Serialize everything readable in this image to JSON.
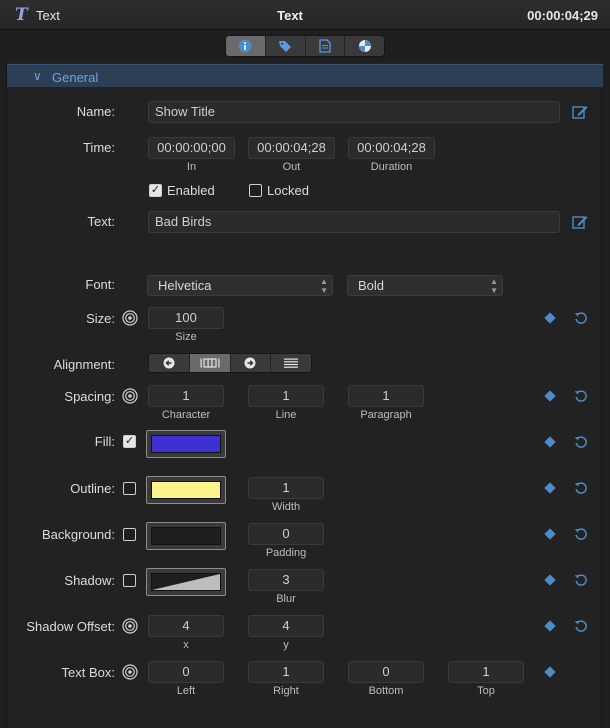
{
  "titlebar": {
    "icon": "T",
    "name": "Text",
    "title": "Text",
    "timecode": "00:00:04;29"
  },
  "tabs": [
    {
      "name": "info-icon",
      "active": true
    },
    {
      "name": "tag-icon",
      "active": false
    },
    {
      "name": "document-icon",
      "active": false
    },
    {
      "name": "color-wheel-icon",
      "active": false
    }
  ],
  "section": {
    "label": "General",
    "chevron": "∨"
  },
  "name": {
    "label": "Name:",
    "value": "Show Title"
  },
  "time": {
    "label": "Time:",
    "in": {
      "value": "00:00:00;00",
      "caption": "In"
    },
    "out": {
      "value": "00:00:04;28",
      "caption": "Out"
    },
    "duration": {
      "value": "00:00:04;28",
      "caption": "Duration"
    },
    "enabled": {
      "label": "Enabled",
      "checked": true
    },
    "locked": {
      "label": "Locked",
      "checked": false
    }
  },
  "text": {
    "label": "Text:",
    "value": "Bad Birds"
  },
  "font": {
    "label": "Font:",
    "family": "Helvetica",
    "style": "Bold"
  },
  "size": {
    "label": "Size:",
    "value": "100",
    "caption": "Size"
  },
  "alignment": {
    "label": "Alignment:",
    "selected": "center"
  },
  "spacing": {
    "label": "Spacing:",
    "character": {
      "value": "1",
      "caption": "Character"
    },
    "line": {
      "value": "1",
      "caption": "Line"
    },
    "paragraph": {
      "value": "1",
      "caption": "Paragraph"
    }
  },
  "fill": {
    "label": "Fill:",
    "checked": true,
    "color": "#3e2fd3"
  },
  "outline": {
    "label": "Outline:",
    "checked": false,
    "color": "#faf48a",
    "width": {
      "value": "1",
      "caption": "Width"
    }
  },
  "background": {
    "label": "Background:",
    "checked": false,
    "color": "#1f1f1f",
    "padding": {
      "value": "0",
      "caption": "Padding"
    }
  },
  "shadow": {
    "label": "Shadow:",
    "checked": false,
    "blur": {
      "value": "3",
      "caption": "Blur"
    }
  },
  "shadow_offset": {
    "label": "Shadow Offset:",
    "x": {
      "value": "4",
      "caption": "x"
    },
    "y": {
      "value": "4",
      "caption": "y"
    }
  },
  "text_box": {
    "label": "Text Box:",
    "left": {
      "value": "0",
      "caption": "Left"
    },
    "right": {
      "value": "1",
      "caption": "Right"
    },
    "bottom": {
      "value": "0",
      "caption": "Bottom"
    },
    "top": {
      "value": "1",
      "caption": "Top"
    }
  },
  "colors": {
    "accent": "#4c8cc9",
    "section_bg": "#2d3f55",
    "section_text": "#6ea2e2"
  }
}
